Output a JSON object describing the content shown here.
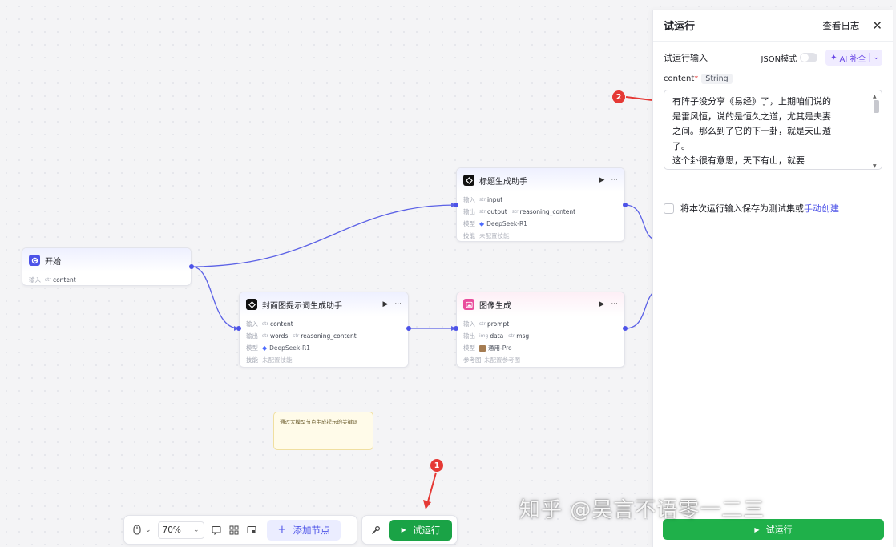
{
  "nodes": {
    "start": {
      "title": "开始",
      "input_label": "输入",
      "inputs": [
        {
          "kind": "str",
          "name": "content"
        }
      ]
    },
    "title_assistant": {
      "title": "标题生成助手",
      "input_label": "输入",
      "output_label": "输出",
      "model_label": "模型",
      "skill_label": "技能",
      "inputs": [
        {
          "kind": "str",
          "name": "input"
        }
      ],
      "outputs": [
        {
          "kind": "str",
          "name": "output"
        },
        {
          "kind": "str",
          "name": "reasoning_content"
        }
      ],
      "model": "DeepSeek-R1",
      "skill": "未配置技能"
    },
    "cover_prompt_assistant": {
      "title": "封面图提示词生成助手",
      "input_label": "输入",
      "output_label": "输出",
      "model_label": "模型",
      "skill_label": "技能",
      "inputs": [
        {
          "kind": "str",
          "name": "content"
        }
      ],
      "outputs": [
        {
          "kind": "str",
          "name": "words"
        },
        {
          "kind": "str",
          "name": "reasoning_content"
        }
      ],
      "model": "DeepSeek-R1",
      "skill": "未配置技能"
    },
    "image_gen": {
      "title": "图像生成",
      "input_label": "输入",
      "output_label": "输出",
      "model_label": "模型",
      "ref_label": "参考图",
      "inputs": [
        {
          "kind": "str",
          "name": "prompt"
        }
      ],
      "outputs": [
        {
          "kind": "img",
          "name": "data"
        },
        {
          "kind": "str",
          "name": "msg"
        }
      ],
      "model": "通用-Pro",
      "reference": "未配置参考图"
    }
  },
  "note": {
    "text": "通过大模型节点生成提示的关键词"
  },
  "toolbar": {
    "zoom": "70%",
    "add_node_label": "添加节点",
    "run_label": "试运行"
  },
  "panel": {
    "title": "试运行",
    "view_logs": "查看日志",
    "input_section": "试运行输入",
    "json_mode_label": "JSON模式",
    "json_mode_on": false,
    "ai_fill_label": "AI 补全",
    "field": {
      "name": "content",
      "required_mark": "*",
      "type": "String",
      "value": "有阵子没分享《易经》了，上期咱们说的\n是雷风恒，说的是恒久之道，尤其是夫妻\n之间。那么到了它的下一卦，就是天山遁\n了。\n这个卦很有意思，天下有山，就要"
    },
    "save_text": "将本次运行输入保存为测试集或",
    "save_link": "手动创建",
    "run_label": "试运行"
  },
  "annotations": {
    "badge_1": "1",
    "badge_2": "2"
  },
  "watermark": "知乎 @吴言不语零一二三",
  "colors": {
    "accent": "#4d53e8",
    "run_green": "#1aa346",
    "annotation_red": "#e53935",
    "ai_purple": "#6846e6"
  }
}
